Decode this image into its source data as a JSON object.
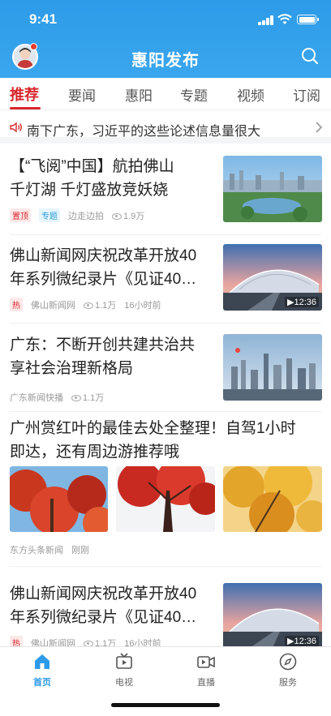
{
  "status_bar": {
    "time": "9:41"
  },
  "header": {
    "title": "惠阳发布"
  },
  "tabs": [
    {
      "label": "推荐",
      "active": true
    },
    {
      "label": "要闻"
    },
    {
      "label": "惠阳"
    },
    {
      "label": "专题"
    },
    {
      "label": "视频"
    },
    {
      "label": "订阅"
    }
  ],
  "ticker": {
    "text": "南下广东，习近平的这些论述信息量很大"
  },
  "feed": [
    {
      "title_line1": "【“飞阅”中国】航拍佛山",
      "title_line2": "千灯湖 千灯盛放竞妖娆",
      "tags": [
        "置顶",
        "专题"
      ],
      "source": "边走边拍",
      "views": "1.9万"
    },
    {
      "title_line1": "佛山新闻网庆祝改革开放40",
      "title_line2": "年系列微纪录片《见证40…",
      "tag": "热",
      "source": "佛山新闻网",
      "views": "1.1万",
      "time": "16小时前",
      "duration": "12:36"
    },
    {
      "title_line1": "广东：不断开创共建共治共",
      "title_line2": "享社会治理新格局",
      "source": "广东新闻快播",
      "views": "1.1万"
    },
    {
      "title_line1": "广州赏红叶的最佳去处全整理！自驾1小时",
      "title_line2": "即达，还有周边游推荐哦",
      "source": "东方头条新闻",
      "time": "刚刚"
    },
    {
      "title_line1": "佛山新闻网庆祝改革开放40",
      "title_line2": "年系列微纪录片《见证40…",
      "tag": "热",
      "source": "佛山新闻网",
      "views": "1.1万",
      "time": "16小时前",
      "duration": "12:36"
    }
  ],
  "bottom_nav": [
    {
      "label": "首页",
      "icon": "home-icon",
      "active": true
    },
    {
      "label": "电视",
      "icon": "tv-icon"
    },
    {
      "label": "直播",
      "icon": "live-camera-icon"
    },
    {
      "label": "服务",
      "icon": "compass-icon"
    }
  ],
  "colors": {
    "brand_blue": "#2d9be8",
    "accent_red": "#d8262c"
  }
}
